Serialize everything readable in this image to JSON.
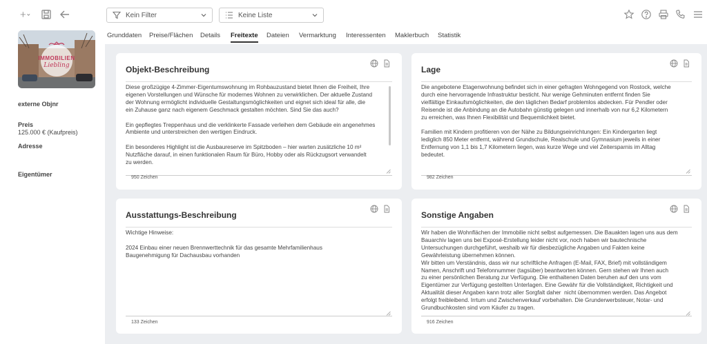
{
  "filter": {
    "label": "Kein Filter"
  },
  "list": {
    "label": "Keine Liste"
  },
  "tabs": [
    {
      "label": "Grunddaten"
    },
    {
      "label": "Preise/Flächen"
    },
    {
      "label": "Details"
    },
    {
      "label": "Freitexte",
      "active": true
    },
    {
      "label": "Dateien"
    },
    {
      "label": "Vermarktung"
    },
    {
      "label": "Interessenten"
    },
    {
      "label": "Maklerbuch"
    },
    {
      "label": "Statistik"
    }
  ],
  "sidebar": {
    "logo_line1": "IMMOBILIEN",
    "logo_line2": "Liebling",
    "external_label": "externe Objnr",
    "price_label": "Preis",
    "price_value": "125.000 € (Kaufpreis)",
    "address_label": "Adresse",
    "owner_label": "Eigentümer"
  },
  "cards": {
    "objekt": {
      "title": "Objekt-Beschreibung",
      "text": "Diese großzügige 4-Zimmer-Eigentumswohnung im Rohbauzustand bietet Ihnen die Freiheit, Ihre\neigenen Vorstellungen und Wünsche für modernes Wohnen zu verwirklichen. Der aktuelle Zustand\nder Wohnung ermöglicht individuelle Gestaltungsmöglichkeiten und eignet sich ideal für alle, die\nein Zuhause ganz nach eigenem Geschmack gestalten möchten. Sind Sie das auch?\n\nEin gepflegtes Treppenhaus und die verklinkerte Fassade verleihen dem Gebäude ein angenehmes\nAmbiente und unterstreichen den wertigen Eindruck.\n\nEin besonderes Highlight ist die Ausbaureserve im Spitzboden – hier warten zusätzliche 10 m²\nNutzfläche darauf, in einen funktionalen Raum für Büro, Hobby oder als Rückzugsort verwandelt\nzu werden.",
      "count": "950 Zeichen"
    },
    "lage": {
      "title": "Lage",
      "text": "Die angebotene Etagenwohnung befindet sich in einer gefragten Wohngegend von Rostock, welche\ndurch eine hervorragende Infrastruktur besticht. Nur wenige Gehminuten entfernt finden Sie\nvielfältige Einkaufsmöglichkeiten, die den täglichen Bedarf problemlos abdecken. Für Pendler oder\nReisende ist die Anbindung an die Autobahn günstig gelegen und innerhalb von nur 6,2 Kilometern\nzu erreichen, was Ihnen Flexibilität und Bequemlichkeit bietet.\n\nFamilien mit Kindern profitieren von der Nähe zu Bildungseinrichtungen: Ein Kindergarten liegt\nlediglich 850 Meter entfernt, während Grundschule, Realschule und Gymnasium jeweils in einer\nEntfernung von 1,1 bis 1,7 Kilometern liegen, was kurze Wege und viel Zeitersparnis im Alltag\nbedeutet.",
      "count": "982 Zeichen"
    },
    "ausstattung": {
      "title": "Ausstattungs-Beschreibung",
      "text": "Wichtige Hinweise:\n\n2024 Einbau einer neuen Brennwerttechnik für das gesamte Mehrfamilienhaus\nBaugenehmigung für Dachausbau vorhanden",
      "count": "133 Zeichen"
    },
    "sonstige": {
      "title": "Sonstige Angaben",
      "text": "Wir haben die Wohnflächen der Immobilie nicht selbst aufgemessen. Die Bauakten lagen uns aus dem\nBauarchiv lagen uns bei Exposé-Erstellung leider nicht vor, noch haben wir bautechnische\nUntersuchungen durchgeführt, weshalb wir für diesbezügliche Angaben und Fakten keine\nGewährleistung übernehmen können.\nWir bitten um Verständnis, dass wir nur schriftliche Anfragen (E-Mail, FAX, Brief) mit vollständigem\nNamen, Anschrift und Telefonnummer (tagsüber) beantworten können. Gern stehen wir Ihnen auch\nzu einer persönlichen Beratung zur Verfügung. Die enthaltenen Daten beruhen auf den uns vom\nEigentümer zur Verfügung gestellten Unterlagen. Eine Gewähr für die Vollständigkeit, Richtigkeit und\nAktualität dieser Angaben kann trotz aller Sorgfalt daher  nicht übernommen werden. Das Angebot\nerfolgt freibleibend. Irrtum und Zwischenverkauf vorbehalten. Die Grunderwerbsteuer, Notar- und\nGrundbuchkosten sind vom Käufer zu tragen.",
      "count": "916 Zeichen"
    }
  }
}
